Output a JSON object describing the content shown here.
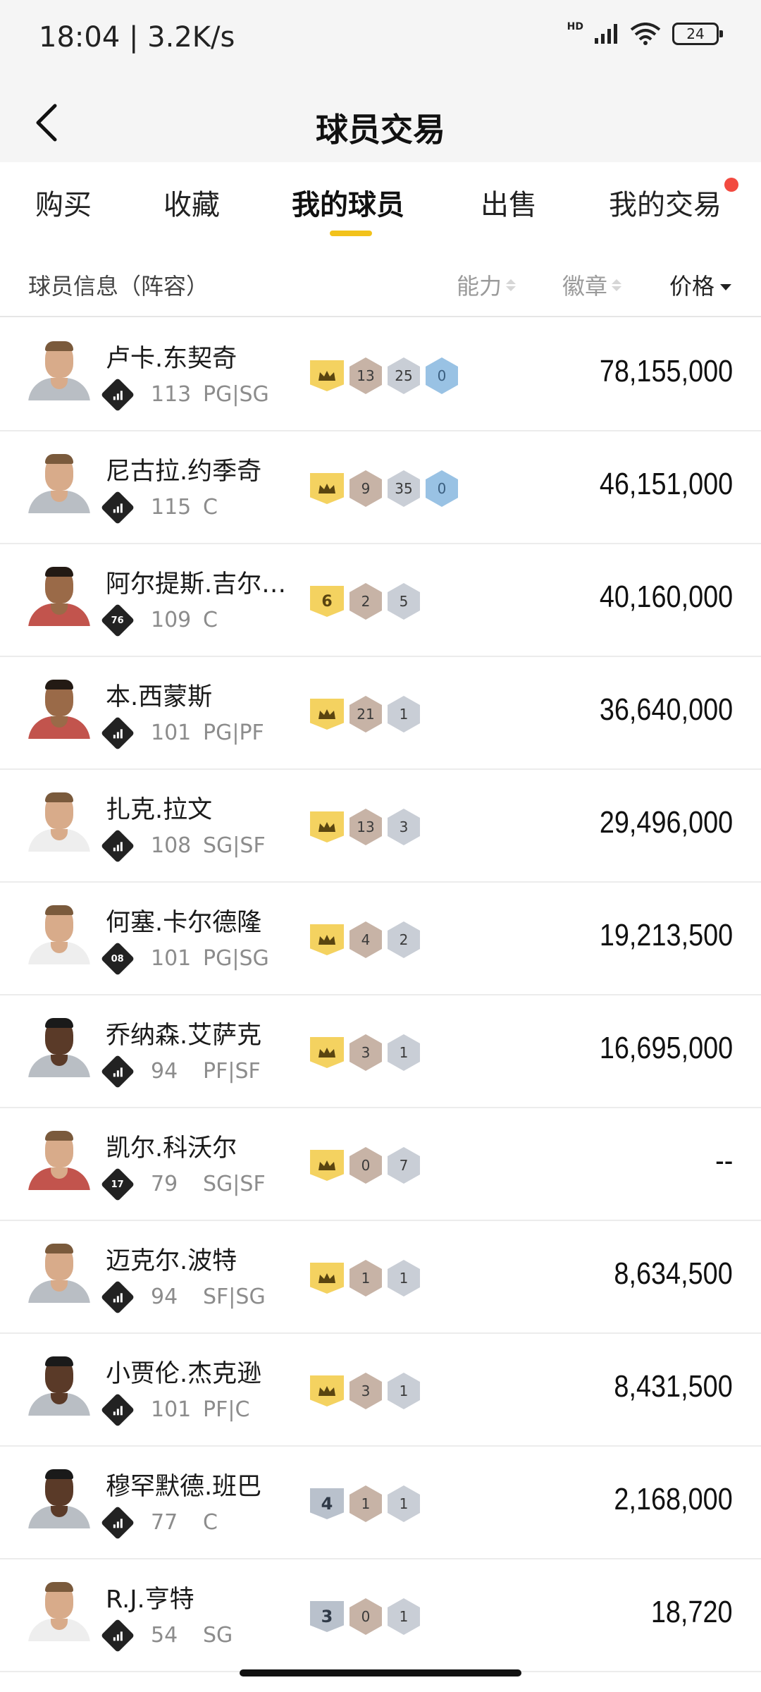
{
  "status_bar": {
    "time": "18:04 | 3.2K/s",
    "network": "HD",
    "battery": "24"
  },
  "nav": {
    "title": "球员交易"
  },
  "tabs": [
    {
      "label": "购买"
    },
    {
      "label": "收藏"
    },
    {
      "label": "我的球员",
      "active": true
    },
    {
      "label": "出售"
    },
    {
      "label": "我的交易",
      "notification_dot": true
    }
  ],
  "columns": {
    "info": "球员信息（阵容）",
    "ability": "能力",
    "badge": "徽章",
    "price": "价格"
  },
  "players": [
    {
      "name": "卢卡.东契奇",
      "team_icon": "bars",
      "ovr": "113",
      "pos": "PG|SG",
      "tier": "crown",
      "badges": [
        "13",
        "25",
        "0"
      ],
      "price": "78,155,000"
    },
    {
      "name": "尼古拉.约季奇",
      "team_icon": "bars",
      "ovr": "115",
      "pos": "C",
      "tier": "crown",
      "badges": [
        "9",
        "35",
        "0"
      ],
      "price": "46,151,000"
    },
    {
      "name": "阿尔提斯.吉尔…",
      "team_icon": "76",
      "ovr": "109",
      "pos": "C",
      "tier": "6",
      "badges": [
        "2",
        "5"
      ],
      "price": "40,160,000"
    },
    {
      "name": "本.西蒙斯",
      "team_icon": "bars",
      "ovr": "101",
      "pos": "PG|PF",
      "tier": "crown",
      "badges": [
        "21",
        "1"
      ],
      "price": "36,640,000"
    },
    {
      "name": "扎克.拉文",
      "team_icon": "bars",
      "ovr": "108",
      "pos": "SG|SF",
      "tier": "crown",
      "badges": [
        "13",
        "3"
      ],
      "price": "29,496,000"
    },
    {
      "name": "何塞.卡尔德隆",
      "team_icon": "08",
      "ovr": "101",
      "pos": "PG|SG",
      "tier": "crown",
      "badges": [
        "4",
        "2"
      ],
      "price": "19,213,500"
    },
    {
      "name": "乔纳森.艾萨克",
      "team_icon": "bars",
      "ovr": "94",
      "pos": "PF|SF",
      "tier": "crown",
      "badges": [
        "3",
        "1"
      ],
      "price": "16,695,000"
    },
    {
      "name": "凯尔.科沃尔",
      "team_icon": "17",
      "ovr": "79",
      "pos": "SG|SF",
      "tier": "crown",
      "badges": [
        "0",
        "7"
      ],
      "price": "--"
    },
    {
      "name": "迈克尔.波特",
      "team_icon": "bars",
      "ovr": "94",
      "pos": "SF|SG",
      "tier": "crown",
      "badges": [
        "1",
        "1"
      ],
      "price": "8,634,500"
    },
    {
      "name": "小贾伦.杰克逊",
      "team_icon": "bars",
      "ovr": "101",
      "pos": "PF|C",
      "tier": "crown",
      "badges": [
        "3",
        "1"
      ],
      "price": "8,431,500"
    },
    {
      "name": "穆罕默德.班巴",
      "team_icon": "bars",
      "ovr": "77",
      "pos": "C",
      "tier": "4",
      "badges": [
        "1",
        "1"
      ],
      "price": "2,168,000"
    },
    {
      "name": "R.J.亨特",
      "team_icon": "bars",
      "ovr": "54",
      "pos": "SG",
      "tier": "3",
      "badges": [
        "0",
        "1"
      ],
      "price": "18,720"
    }
  ],
  "colors": {
    "accent": "#f2c21b",
    "notification": "#f24a40",
    "tier_gold": "#f4d260",
    "badge_bronze": "#c7b3a6",
    "badge_silver": "#c9ced6",
    "badge_blue": "#99c2e4"
  }
}
